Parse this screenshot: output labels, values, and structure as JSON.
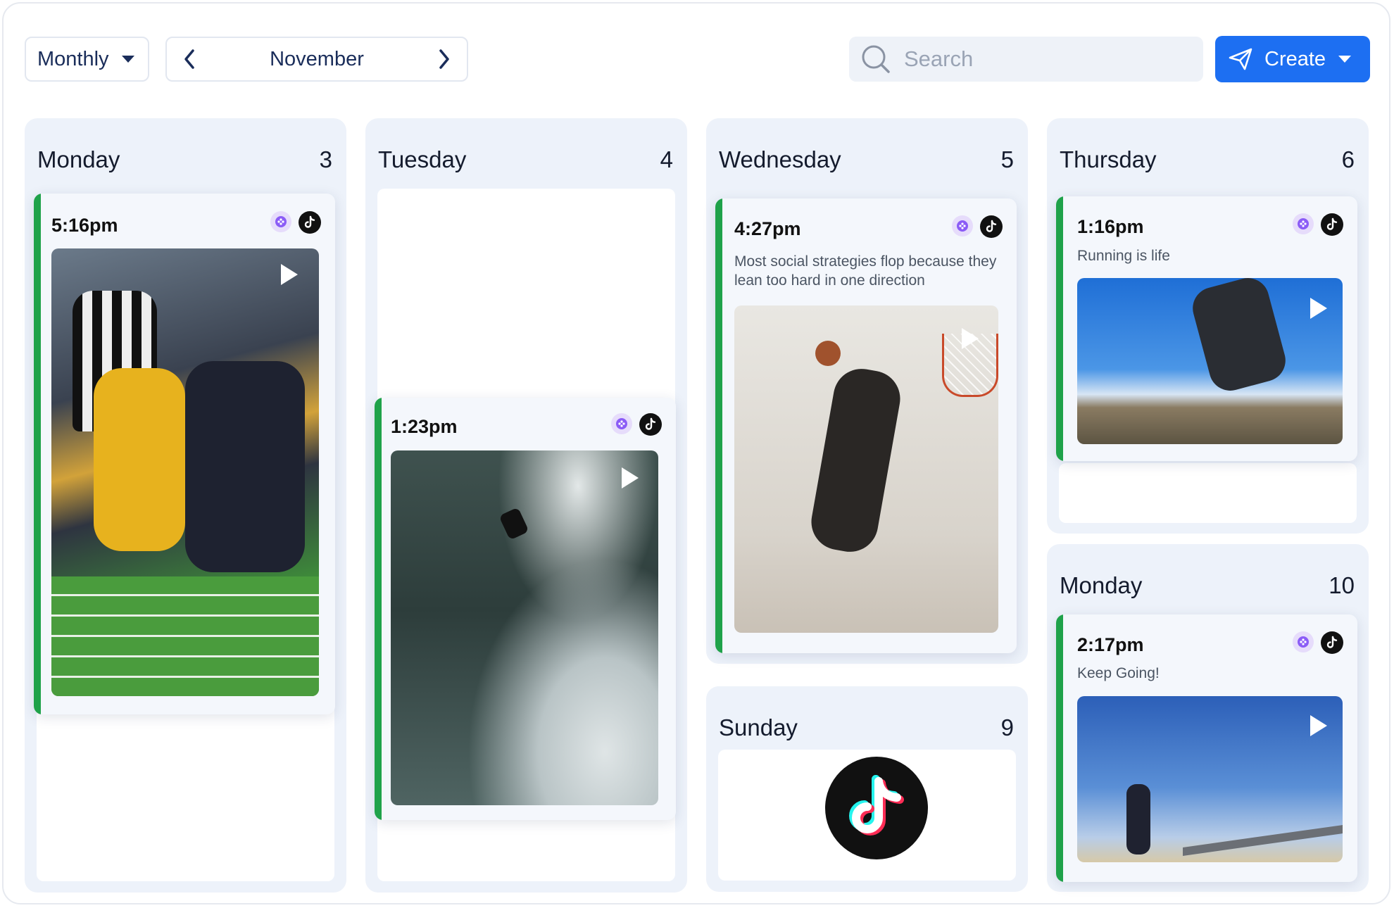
{
  "toolbar": {
    "view_mode": "Monthly",
    "month": "November",
    "search_placeholder": "Search",
    "create_label": "Create"
  },
  "days": [
    {
      "name": "Monday",
      "date": "3"
    },
    {
      "name": "Tuesday",
      "date": "4"
    },
    {
      "name": "Wednesday",
      "date": "5"
    },
    {
      "name": "Thursday",
      "date": "6"
    },
    {
      "name": "Sunday",
      "date": "9"
    },
    {
      "name": "Monday",
      "date": "10"
    }
  ],
  "posts": [
    {
      "time": "5:16pm",
      "caption": "",
      "media": "football-photo"
    },
    {
      "time": "1:23pm",
      "caption": "",
      "media": "surfing-photo"
    },
    {
      "time": "4:27pm",
      "caption": "Most social strategies flop because they lean too hard in one direction",
      "media": "basketball-photo"
    },
    {
      "time": "1:16pm",
      "caption": "Running is life",
      "media": "jumping-photo"
    },
    {
      "time": "2:17pm",
      "caption": "Keep Going!",
      "media": "runner-photo"
    }
  ],
  "colors": {
    "accent": "#1d6ff2",
    "status_bar": "#1fa24a",
    "column_bg": "#edf2fa",
    "platform_badge": "#111111"
  }
}
